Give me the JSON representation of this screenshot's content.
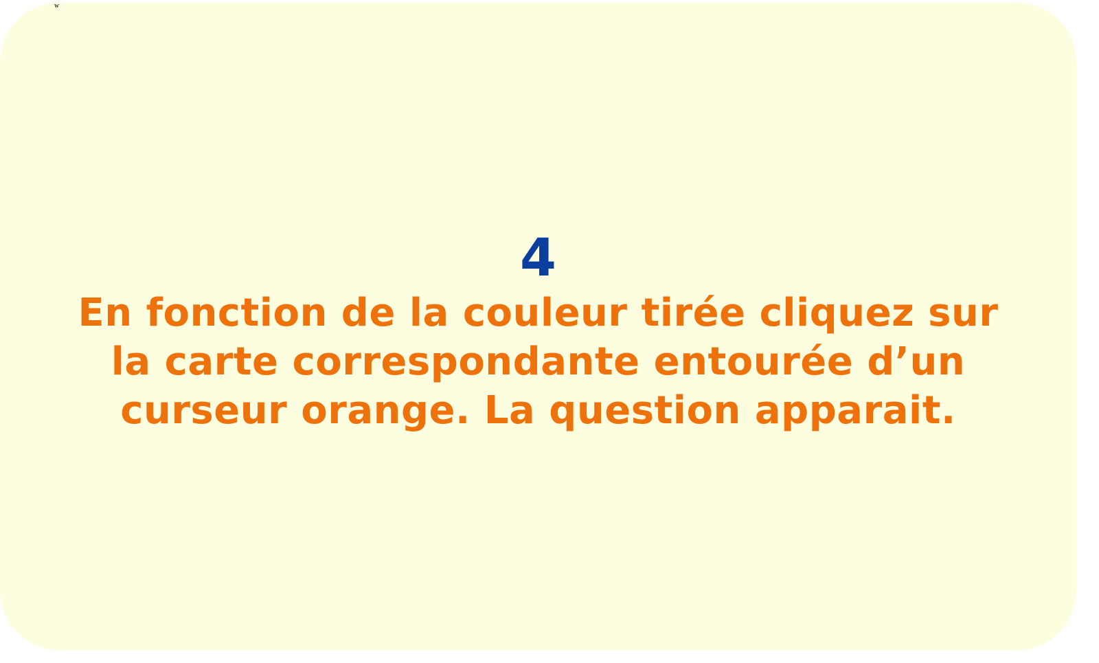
{
  "corner_mark": "w",
  "card": {
    "step_number": "4",
    "instruction": "En fonction de la couleur tirée cliquez sur la carte correspondante entourée d’un curseur orange. La question apparait."
  },
  "colors": {
    "card_background": "#fdfee0",
    "step_number": "#0a3fa0",
    "instruction_text": "#ee720b"
  }
}
